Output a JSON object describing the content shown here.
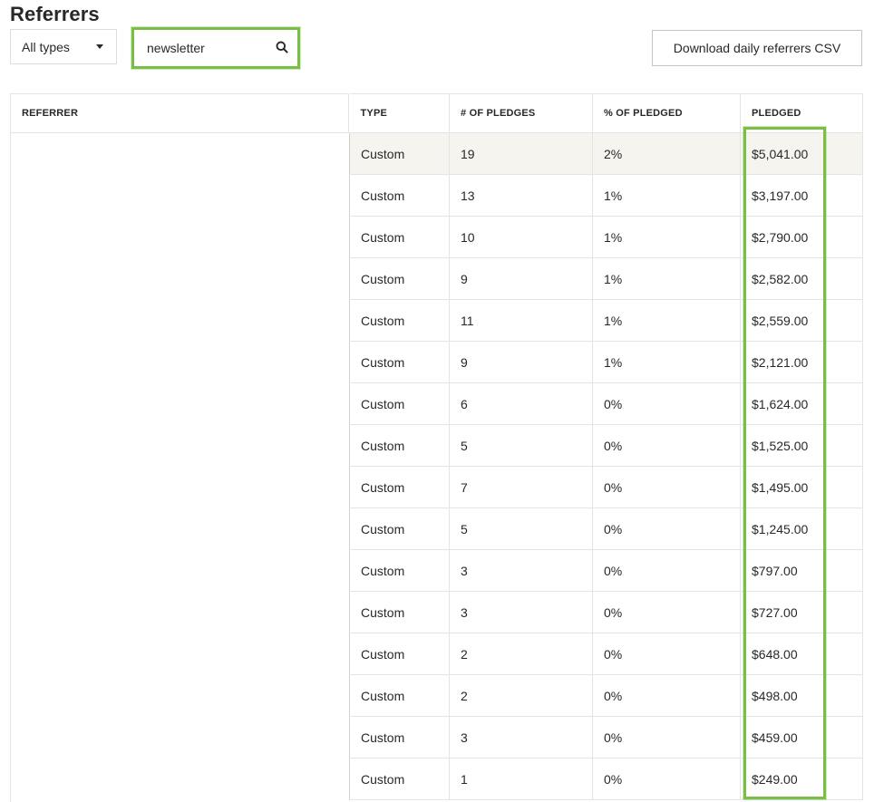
{
  "page": {
    "title": "Referrers"
  },
  "filters": {
    "type_select": {
      "selected": "All types"
    },
    "search": {
      "value": "newsletter",
      "icon": "search-icon"
    }
  },
  "actions": {
    "download_csv_label": "Download daily referrers CSV"
  },
  "table": {
    "columns": {
      "referrer": "REFERRER",
      "type": "TYPE",
      "pledges": "# OF PLEDGES",
      "percent": "% OF PLEDGED",
      "pledged": "PLEDGED"
    },
    "rows": [
      {
        "type": "Custom",
        "pledges": "19",
        "percent": "2%",
        "pledged": "$5,041.00"
      },
      {
        "type": "Custom",
        "pledges": "13",
        "percent": "1%",
        "pledged": "$3,197.00"
      },
      {
        "type": "Custom",
        "pledges": "10",
        "percent": "1%",
        "pledged": "$2,790.00"
      },
      {
        "type": "Custom",
        "pledges": "9",
        "percent": "1%",
        "pledged": "$2,582.00"
      },
      {
        "type": "Custom",
        "pledges": "11",
        "percent": "1%",
        "pledged": "$2,559.00"
      },
      {
        "type": "Custom",
        "pledges": "9",
        "percent": "1%",
        "pledged": "$2,121.00"
      },
      {
        "type": "Custom",
        "pledges": "6",
        "percent": "0%",
        "pledged": "$1,624.00"
      },
      {
        "type": "Custom",
        "pledges": "5",
        "percent": "0%",
        "pledged": "$1,525.00"
      },
      {
        "type": "Custom",
        "pledges": "7",
        "percent": "0%",
        "pledged": "$1,495.00"
      },
      {
        "type": "Custom",
        "pledges": "5",
        "percent": "0%",
        "pledged": "$1,245.00"
      },
      {
        "type": "Custom",
        "pledges": "3",
        "percent": "0%",
        "pledged": "$797.00"
      },
      {
        "type": "Custom",
        "pledges": "3",
        "percent": "0%",
        "pledged": "$727.00"
      },
      {
        "type": "Custom",
        "pledges": "2",
        "percent": "0%",
        "pledged": "$648.00"
      },
      {
        "type": "Custom",
        "pledges": "2",
        "percent": "0%",
        "pledged": "$498.00"
      },
      {
        "type": "Custom",
        "pledges": "3",
        "percent": "0%",
        "pledged": "$459.00"
      },
      {
        "type": "Custom",
        "pledges": "1",
        "percent": "0%",
        "pledged": "$249.00"
      }
    ]
  },
  "colors": {
    "annotation_highlight": "#7abf45",
    "hover_row": "#f6f4ef",
    "text": "#282828",
    "border": "#e4e4e4"
  }
}
